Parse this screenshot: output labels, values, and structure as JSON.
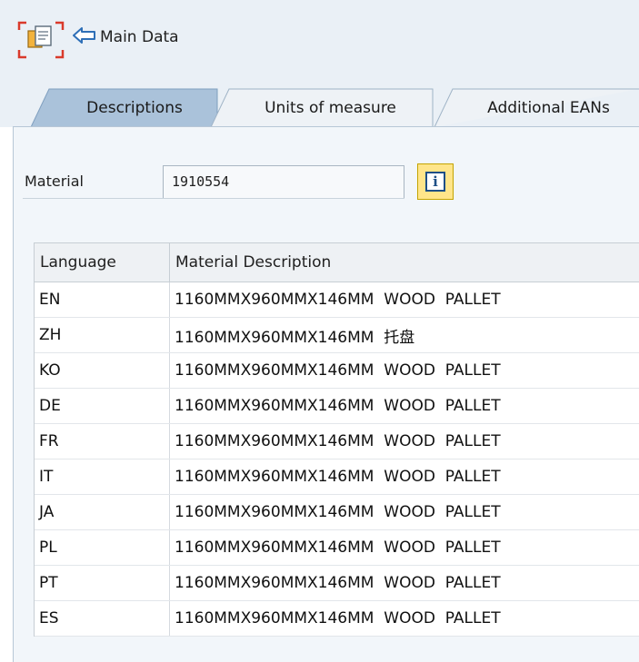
{
  "toolbar": {
    "back_label": "Main Data"
  },
  "tabs": [
    {
      "label": "Descriptions",
      "active": true
    },
    {
      "label": "Units of measure",
      "active": false
    },
    {
      "label": "Additional EANs",
      "active": false
    }
  ],
  "material": {
    "label": "Material",
    "value": "1910554"
  },
  "table": {
    "headers": {
      "language": "Language",
      "description": "Material Description"
    },
    "rows": [
      {
        "language": "EN",
        "description": "1160MMX960MMX146MM  WOOD  PALLET"
      },
      {
        "language": "ZH",
        "description": "1160MMX960MMX146MM  托盘"
      },
      {
        "language": "KO",
        "description": "1160MMX960MMX146MM  WOOD  PALLET"
      },
      {
        "language": "DE",
        "description": "1160MMX960MMX146MM  WOOD  PALLET"
      },
      {
        "language": "FR",
        "description": "1160MMX960MMX146MM  WOOD  PALLET"
      },
      {
        "language": "IT",
        "description": "1160MMX960MMX146MM  WOOD  PALLET"
      },
      {
        "language": "JA",
        "description": "1160MMX960MMX146MM  WOOD  PALLET"
      },
      {
        "language": "PL",
        "description": "1160MMX960MMX146MM  WOOD  PALLET"
      },
      {
        "language": "PT",
        "description": "1160MMX960MMX146MM  WOOD  PALLET"
      },
      {
        "language": "ES",
        "description": "1160MMX960MMX146MM  WOOD  PALLET"
      }
    ]
  },
  "icons": {
    "toolbar_button": "copy-document-icon",
    "back": "arrow-left-icon",
    "info": "info-icon"
  }
}
